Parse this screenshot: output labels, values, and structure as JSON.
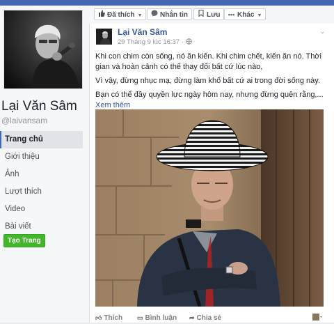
{
  "page": {
    "name": "Lại Văn Sâm",
    "handle": "@laivansam"
  },
  "nav": {
    "items": [
      {
        "label": "Trang chủ",
        "active": true
      },
      {
        "label": "Giới thiệu"
      },
      {
        "label": "Ảnh"
      },
      {
        "label": "Lượt thích"
      },
      {
        "label": "Video"
      },
      {
        "label": "Bài viết"
      }
    ],
    "create_page": "Tạo Trang"
  },
  "actions": {
    "like": "Đã thích",
    "message": "Nhắn tin",
    "save": "Lưu",
    "more": "Khác"
  },
  "post": {
    "author": "Lại Văn Sâm",
    "timestamp": "29 Tháng 9 lúc 16:37 · ",
    "paragraphs": [
      "Khi con chim còn sống, nó ăn kiến. Khi chim chết, kiến ăn nó. Thời gian và hoàn cảnh có thể thay đổi bất cứ lúc nào,",
      "Vì vậy, đừng nhục mạ, đừng làm khổ bất cứ ai trong đời sống này.",
      "Bạn có thể đầy quyền lực ngày hôm nay, nhưng đừng quên rằng,..."
    ],
    "see_more": "Xem thêm"
  },
  "footer": {
    "like": "Thích",
    "comment": "Bình luận",
    "share": "Chia sẻ"
  },
  "colors": {
    "brand": "#4267b2",
    "link": "#365899",
    "create_button": "#42b72a"
  },
  "icons": [
    "thumbs-up-icon",
    "message-icon",
    "bookmark-icon",
    "chevron-down-icon",
    "globe-icon",
    "comment-icon",
    "share-icon",
    "reaction-avatar-icon"
  ]
}
